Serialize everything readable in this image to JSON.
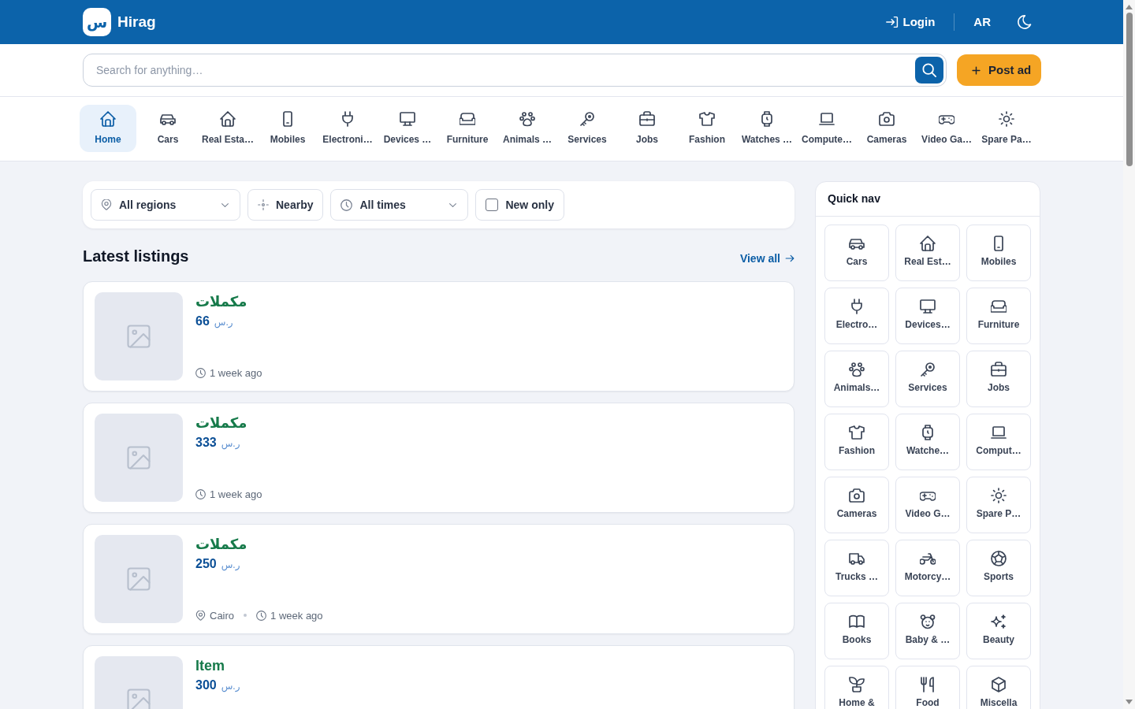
{
  "header": {
    "logo_glyph": "س",
    "brand": "Hirag",
    "login": "Login",
    "language": "AR"
  },
  "search": {
    "placeholder": "Search for anything…",
    "post_ad": "Post ad"
  },
  "categories": [
    {
      "label": "Home",
      "selected": true
    },
    {
      "label": "Cars",
      "selected": false
    },
    {
      "label": "Real Esta…",
      "selected": false
    },
    {
      "label": "Mobiles",
      "selected": false
    },
    {
      "label": "Electroni…",
      "selected": false
    },
    {
      "label": "Devices …",
      "selected": false
    },
    {
      "label": "Furniture",
      "selected": false
    },
    {
      "label": "Animals …",
      "selected": false
    },
    {
      "label": "Services",
      "selected": false
    },
    {
      "label": "Jobs",
      "selected": false
    },
    {
      "label": "Fashion",
      "selected": false
    },
    {
      "label": "Watches …",
      "selected": false
    },
    {
      "label": "Compute…",
      "selected": false
    },
    {
      "label": "Cameras",
      "selected": false
    },
    {
      "label": "Video Ga…",
      "selected": false
    },
    {
      "label": "Spare Pa…",
      "selected": false
    }
  ],
  "filters": {
    "region": "All regions",
    "nearby": "Nearby",
    "period": "All times",
    "new_only": {
      "label": "New only",
      "checked": false
    }
  },
  "latest": {
    "title": "Latest listings",
    "view_all": "View all",
    "listings": [
      {
        "title": "مكملات",
        "price": "66",
        "currency": "ر.س",
        "time": "1 week ago"
      },
      {
        "title": "مكملات",
        "price": "333",
        "currency": "ر.س",
        "time": "1 week ago"
      },
      {
        "title": "مكملات",
        "price": "250",
        "currency": "ر.س",
        "location": "Cairo",
        "time": "1 week ago"
      },
      {
        "title": "Item",
        "price": "300",
        "currency": "ر.س"
      }
    ]
  },
  "quick_nav": {
    "title": "Quick nav",
    "items": [
      "Cars",
      "Real Est…",
      "Mobiles",
      "Electro…",
      "Devices…",
      "Furniture",
      "Animals…",
      "Services",
      "Jobs",
      "Fashion",
      "Watche…",
      "Comput…",
      "Cameras",
      "Video G…",
      "Spare P…",
      "Trucks …",
      "Motorcy…",
      "Sports",
      "Books",
      "Baby & …",
      "Beauty",
      "Home &",
      "Food",
      "Miscella"
    ]
  }
}
